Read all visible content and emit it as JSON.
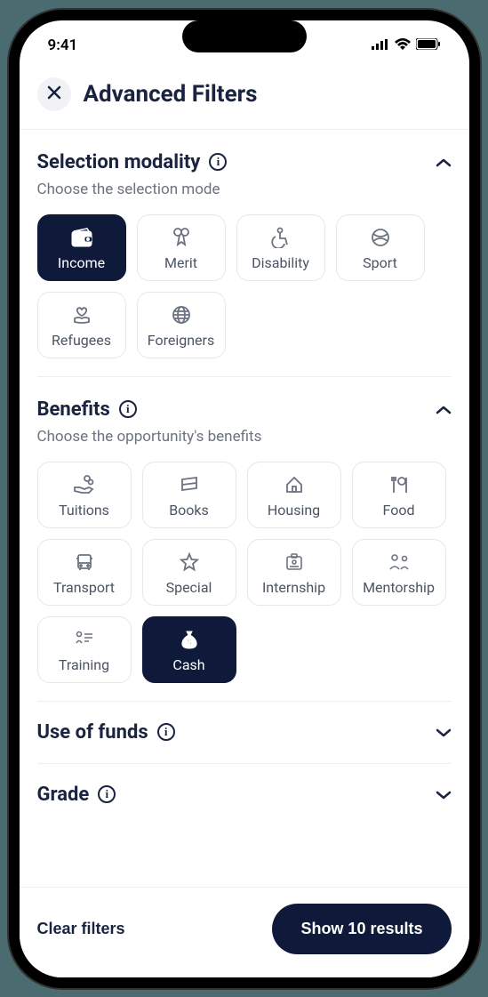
{
  "statusbar": {
    "time": "9:41"
  },
  "header": {
    "title": "Advanced Filters"
  },
  "sections": {
    "selection": {
      "title": "Selection modality",
      "subtitle": "Choose the selection mode",
      "items": [
        {
          "label": "Income",
          "selected": true
        },
        {
          "label": "Merit",
          "selected": false
        },
        {
          "label": "Disability",
          "selected": false
        },
        {
          "label": "Sport",
          "selected": false
        },
        {
          "label": "Refugees",
          "selected": false
        },
        {
          "label": "Foreigners",
          "selected": false
        }
      ]
    },
    "benefits": {
      "title": "Benefits",
      "subtitle": "Choose the opportunity's benefits",
      "items": [
        {
          "label": "Tuitions",
          "selected": false
        },
        {
          "label": "Books",
          "selected": false
        },
        {
          "label": "Housing",
          "selected": false
        },
        {
          "label": "Food",
          "selected": false
        },
        {
          "label": "Transport",
          "selected": false
        },
        {
          "label": "Special",
          "selected": false
        },
        {
          "label": "Internship",
          "selected": false
        },
        {
          "label": "Mentorship",
          "selected": false
        },
        {
          "label": "Training",
          "selected": false
        },
        {
          "label": "Cash",
          "selected": true
        }
      ]
    },
    "use_of_funds": {
      "title": "Use of funds"
    },
    "grade": {
      "title": "Grade"
    }
  },
  "footer": {
    "clear": "Clear filters",
    "results": "Show 10 results"
  }
}
